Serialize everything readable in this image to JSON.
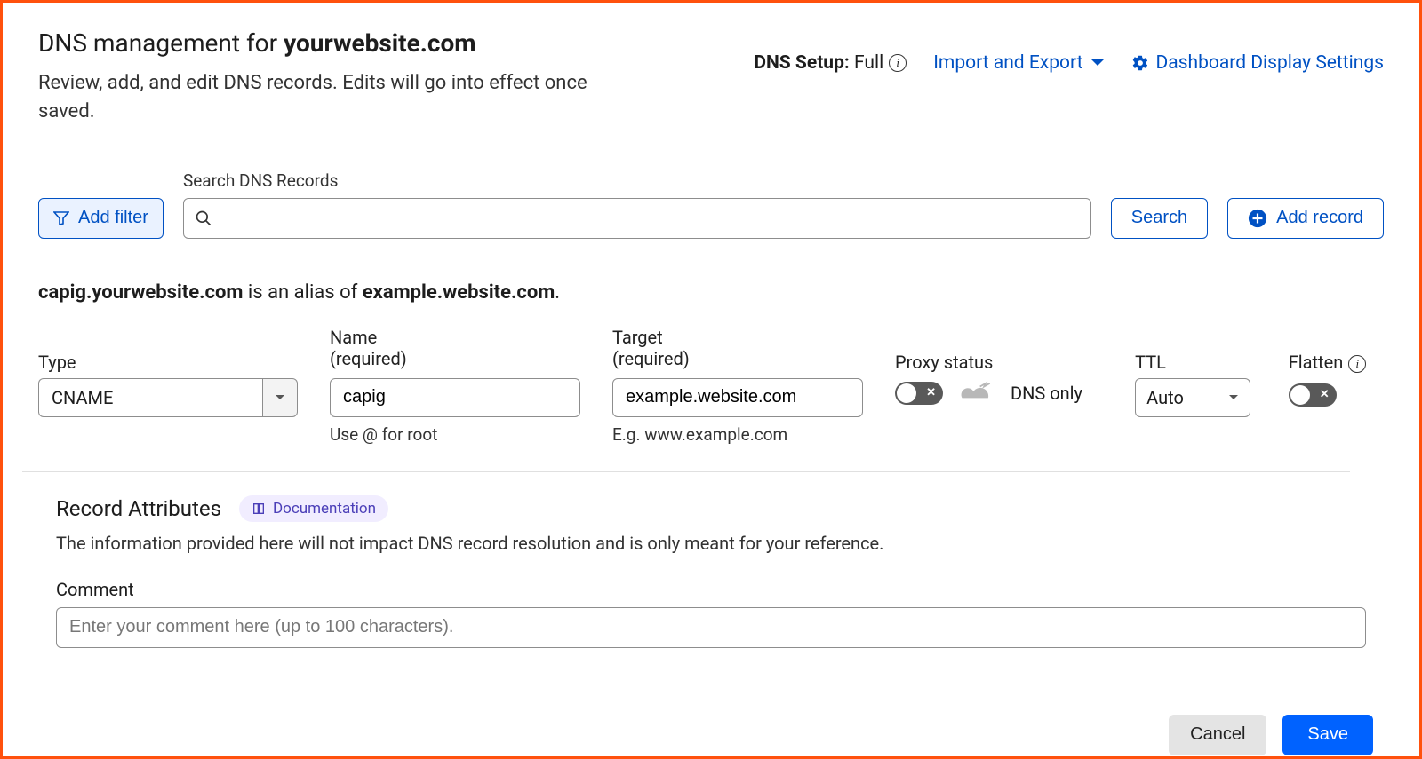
{
  "header": {
    "title_prefix": "DNS management for ",
    "title_domain": "yourwebsite.com",
    "subtitle": "Review, add, and edit DNS records. Edits will go into effect once saved.",
    "dns_setup_label": "DNS Setup:",
    "dns_setup_value": "Full",
    "import_export": "Import and Export",
    "display_settings": "Dashboard Display Settings"
  },
  "search": {
    "add_filter": "Add filter",
    "label": "Search DNS Records",
    "placeholder": "",
    "search_btn": "Search",
    "add_record_btn": "Add record"
  },
  "alias": {
    "host": "capig.yourwebsite.com",
    "mid": " is an alias of ",
    "target": "example.website.com",
    "suffix": "."
  },
  "form": {
    "type_label": "Type",
    "type_value": "CNAME",
    "name_label": "Name",
    "required": "(required)",
    "name_value": "capig",
    "name_help": "Use @ for root",
    "target_label": "Target",
    "target_value": "example.website.com",
    "target_help": "E.g. www.example.com",
    "proxy_label": "Proxy status",
    "proxy_value": "DNS only",
    "ttl_label": "TTL",
    "ttl_value": "Auto",
    "flatten_label": "Flatten"
  },
  "attributes": {
    "heading": "Record Attributes",
    "doc_link": "Documentation",
    "description": "The information provided here will not impact DNS record resolution and is only meant for your reference.",
    "comment_label": "Comment",
    "comment_placeholder": "Enter your comment here (up to 100 characters)."
  },
  "footer": {
    "cancel": "Cancel",
    "save": "Save"
  }
}
